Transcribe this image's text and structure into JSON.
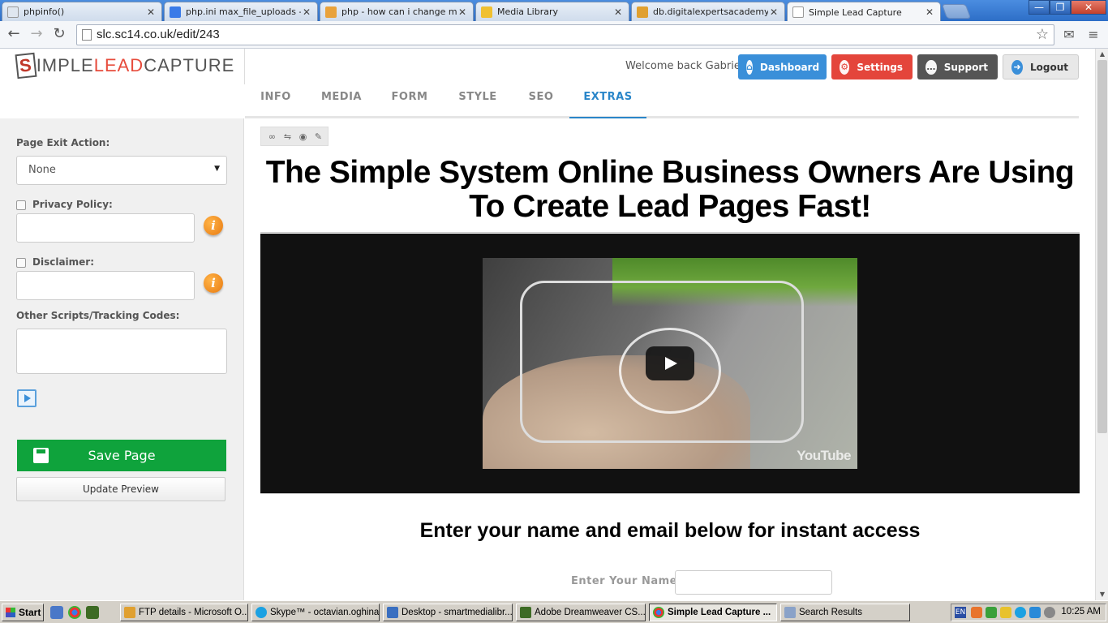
{
  "browser": {
    "tabs": [
      {
        "label": "phpinfo()",
        "favicon": "page-icon",
        "color": "#dfe6ef"
      },
      {
        "label": "php.ini max_file_uploads - Go",
        "favicon": "google-icon",
        "color": "#3a7be8"
      },
      {
        "label": "php - how can i change max_",
        "favicon": "stackoverflow-icon",
        "color": "#e9a23b"
      },
      {
        "label": "Media Library",
        "favicon": "folder-icon",
        "color": "#f0c030"
      },
      {
        "label": "db.digitalexpertsacademy.co",
        "favicon": "phpmyadmin-icon",
        "color": "#e0a030"
      },
      {
        "label": "Simple Lead Capture",
        "favicon": "page-icon",
        "color": "#dfe6ef"
      }
    ],
    "close_glyph": "✕",
    "window_controls": {
      "minimize": "—",
      "maximize": "❐",
      "close": "✕"
    },
    "url": "slc.sc14.co.uk/edit/243"
  },
  "header": {
    "logo": {
      "s": "S",
      "imple": "IMPLE",
      "lead": "LEAD",
      "capture": "CAPTURE"
    },
    "welcome": "Welcome back Gabriel",
    "buttons": {
      "dashboard": "Dashboard",
      "settings": "Settings",
      "support": "Support",
      "logout": "Logout"
    }
  },
  "tabs": [
    "INFO",
    "MEDIA",
    "FORM",
    "STYLE",
    "SEO",
    "EXTRAS"
  ],
  "active_tab": "EXTRAS",
  "sidebar": {
    "page_exit_label": "Page Exit Action:",
    "page_exit_value": "None",
    "privacy_label": "Privacy Policy:",
    "disclaimer_label": "Disclaimer:",
    "scripts_label": "Other Scripts/Tracking Codes:",
    "save_label": "Save Page",
    "update_label": "Update Preview"
  },
  "preview": {
    "headline": "The Simple System Online Business Owners Are Using To Create Lead Pages Fast!",
    "video_brand": "YouTube",
    "subhead": "Enter your name and email below for instant access",
    "name_label": "Enter Your Name:"
  },
  "taskbar": {
    "start": "Start",
    "tasks": [
      {
        "label": "FTP details - Microsoft O...",
        "color": "#e0a030"
      },
      {
        "label": "Skype™ - octavian.oghina",
        "color": "#1ba1e2"
      },
      {
        "label": "Desktop - smartmedialibr...",
        "color": "#3a6fc0"
      },
      {
        "label": "Adobe Dreamweaver CS...",
        "color": "#3d6b24"
      },
      {
        "label": "Simple Lead Capture ...",
        "color": "#4caf50"
      },
      {
        "label": "Search Results",
        "color": "#8aa2c8"
      }
    ],
    "lang": "EN",
    "clock": "10:25 AM"
  },
  "colors": {
    "dashboard": "#3a8fd9",
    "settings": "#e4453b",
    "support": "#555555",
    "save": "#0fa33c",
    "active_tab": "#2a86c9"
  }
}
